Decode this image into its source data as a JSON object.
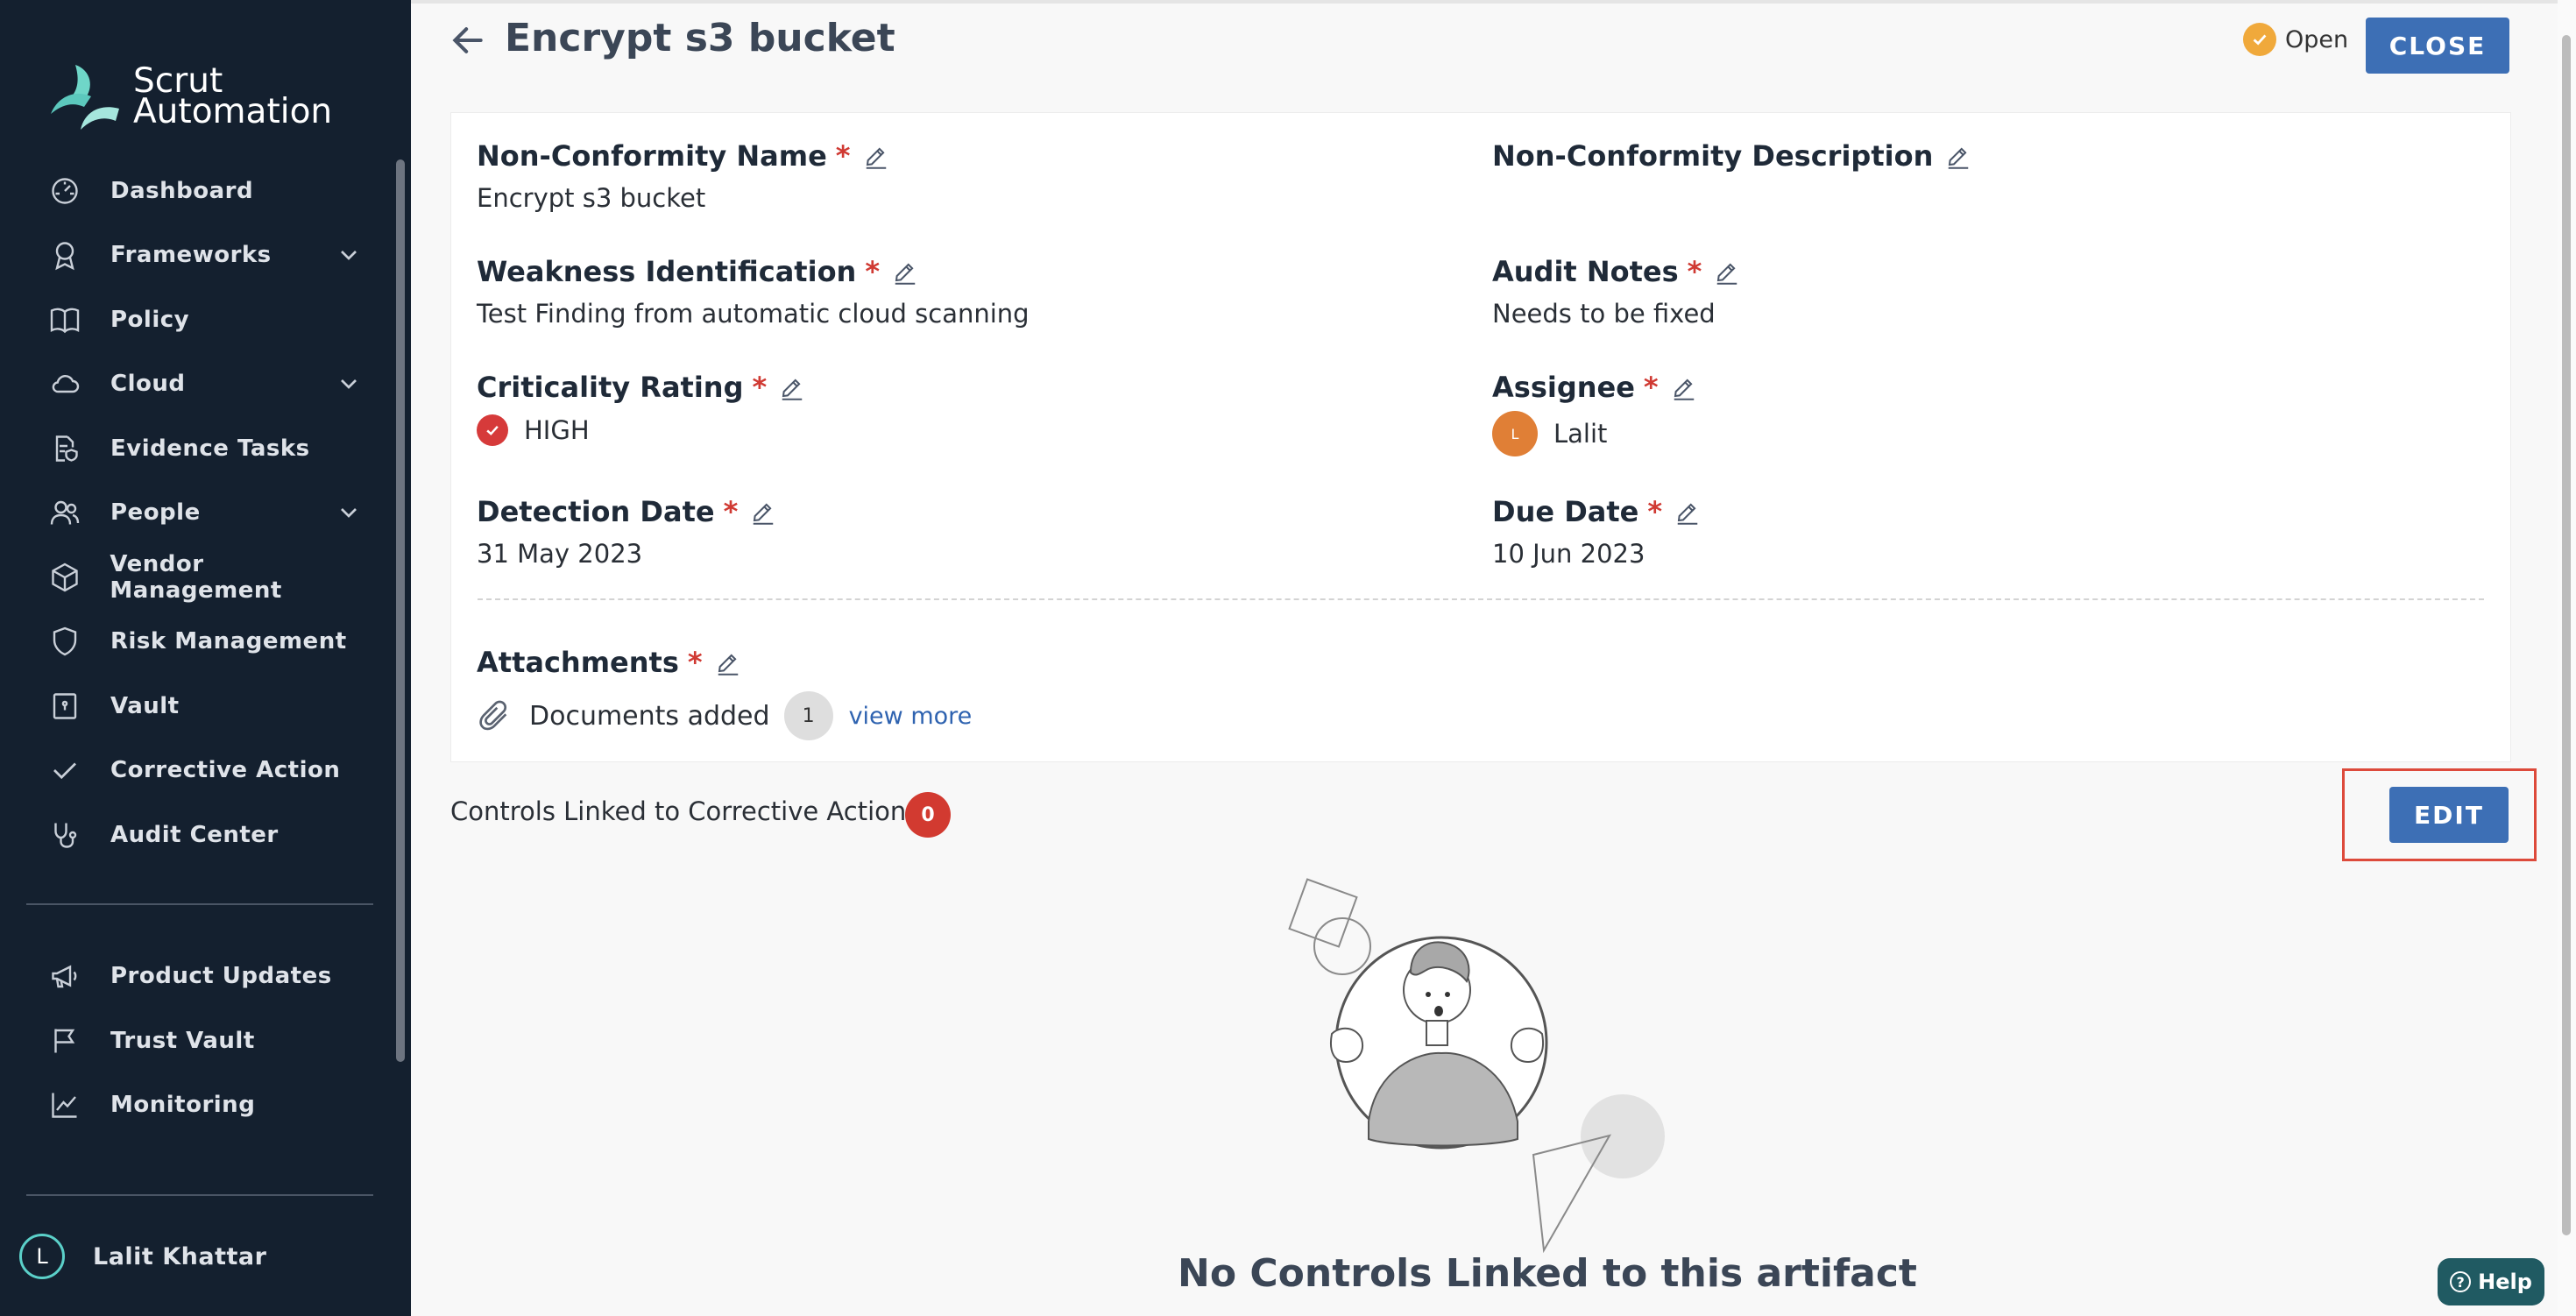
{
  "app": {
    "brand_line1": "Scrut",
    "brand_line2": "Automation"
  },
  "sidebar": {
    "items": [
      {
        "label": "Dashboard",
        "icon": "dashboard-icon"
      },
      {
        "label": "Frameworks",
        "icon": "award-icon",
        "expandable": true
      },
      {
        "label": "Policy",
        "icon": "book-icon"
      },
      {
        "label": "Cloud",
        "icon": "cloud-icon",
        "expandable": true
      },
      {
        "label": "Evidence Tasks",
        "icon": "file-shield-icon"
      },
      {
        "label": "People",
        "icon": "people-icon",
        "expandable": true
      },
      {
        "label": "Vendor Management",
        "icon": "cube-icon"
      },
      {
        "label": "Risk Management",
        "icon": "shield-icon"
      },
      {
        "label": "Vault",
        "icon": "vault-icon"
      },
      {
        "label": "Corrective Action",
        "icon": "check-icon"
      },
      {
        "label": "Audit Center",
        "icon": "stethoscope-icon"
      }
    ],
    "secondary": [
      {
        "label": "Product Updates",
        "icon": "megaphone-icon"
      },
      {
        "label": "Trust Vault",
        "icon": "flag-icon"
      },
      {
        "label": "Monitoring",
        "icon": "chart-line-icon"
      }
    ],
    "user": {
      "initial": "L",
      "name": "Lalit Khattar"
    }
  },
  "header": {
    "title": "Encrypt s3 bucket",
    "status": "Open",
    "close_label": "CLOSE"
  },
  "details": {
    "nc_name_label": "Non-Conformity Name",
    "nc_name_value": "Encrypt s3 bucket",
    "nc_desc_label": "Non-Conformity Description",
    "weakness_label": "Weakness Identification",
    "weakness_value": "Test Finding from automatic cloud scanning",
    "audit_notes_label": "Audit Notes",
    "audit_notes_value": "Needs to be fixed",
    "criticality_label": "Criticality Rating",
    "criticality_value": "HIGH",
    "assignee_label": "Assignee",
    "assignee_initial": "L",
    "assignee_value": "Lalit",
    "detection_label": "Detection Date",
    "detection_value": "31 May 2023",
    "due_label": "Due Date",
    "due_value": "10 Jun 2023",
    "attachments_label": "Attachments",
    "attachments_text": "Documents added",
    "attachments_count": "1",
    "view_more": "view more",
    "required_mark": "*"
  },
  "controls": {
    "label": "Controls Linked to Corrective Action",
    "count": "0",
    "edit_label": "EDIT",
    "empty_text": "No Controls Linked to this artifact"
  },
  "help": {
    "label": "Help",
    "icon_glyph": "?"
  },
  "colors": {
    "sidebar_bg": "#14202f",
    "primary_button": "#3d6fb5",
    "required": "#d03a33",
    "status_open": "#f0a93b",
    "criticality_high": "#d63a3a",
    "highlight_border": "#dd4a3b",
    "help_bg": "#205a62"
  }
}
